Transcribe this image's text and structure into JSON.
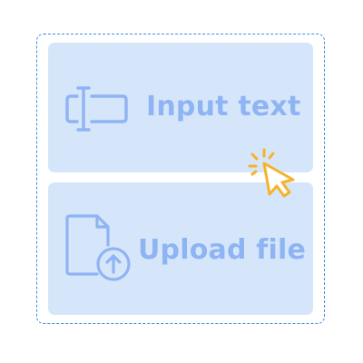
{
  "options": {
    "input_text_label": "Input text",
    "upload_file_label": "Upload file"
  },
  "icons": {
    "input": "text-cursor-field-icon",
    "upload": "file-upload-icon",
    "pointer": "click-pointer-icon"
  },
  "colors": {
    "card_fill": "#d6e6fa",
    "icon_and_label": "#8fb4f3",
    "dashed_border": "#3d8fe0",
    "pointer": "#f5b32a"
  }
}
